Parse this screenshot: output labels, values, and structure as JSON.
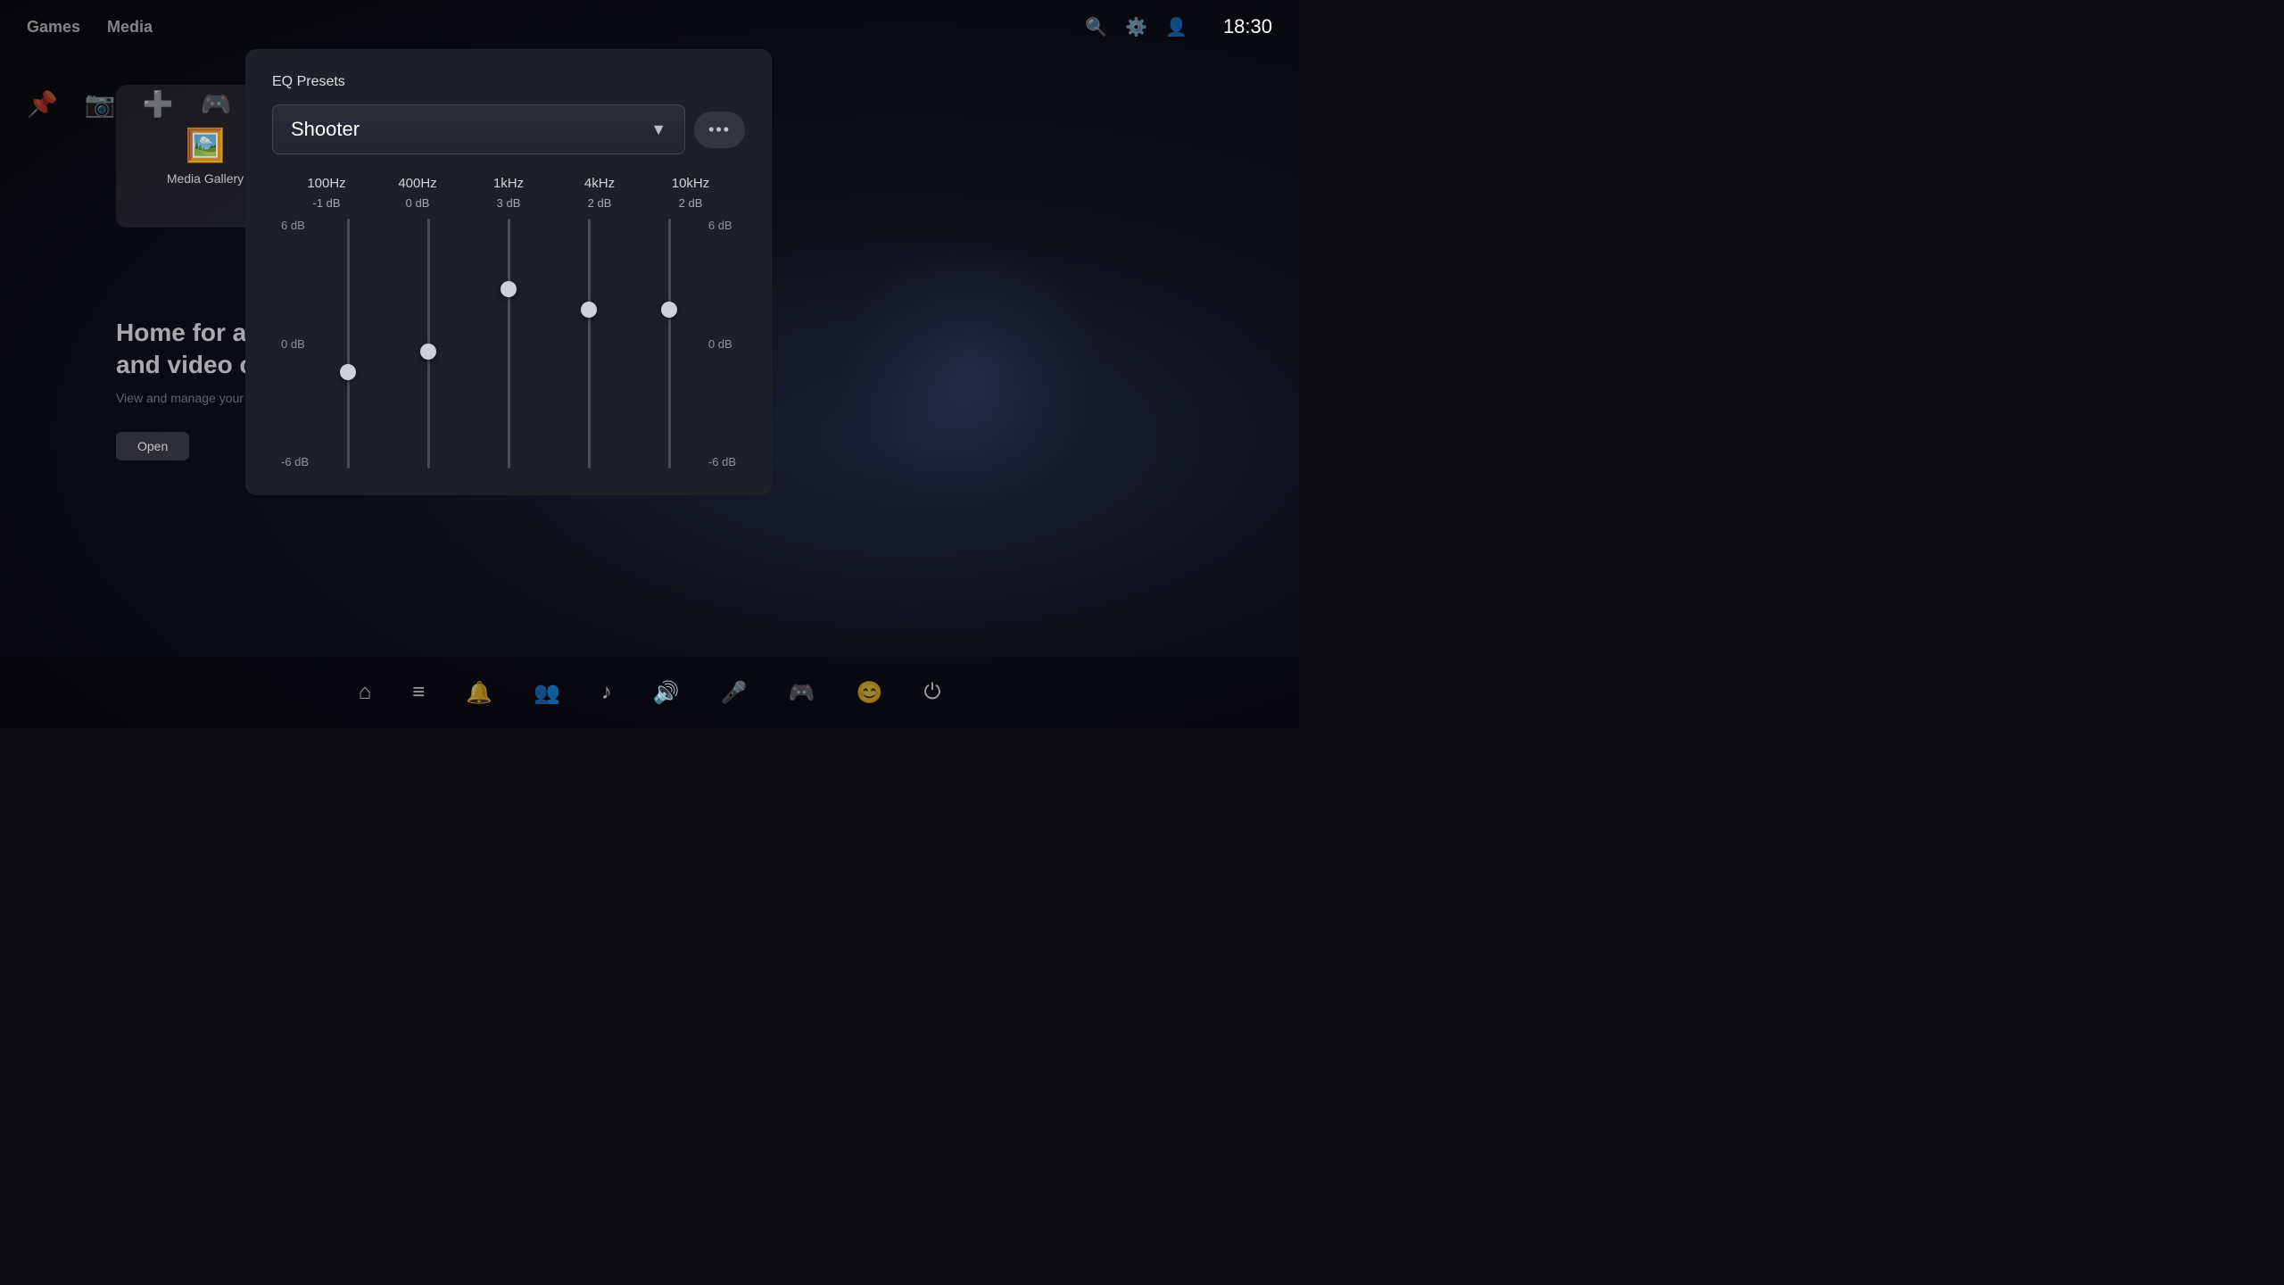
{
  "topNav": {
    "items": [
      "Games",
      "Media"
    ]
  },
  "clock": "18:30",
  "mediaGallery": {
    "label": "Media Gallery"
  },
  "pageContent": {
    "headline": "Home for all your s…",
    "subheadline": "and video clips",
    "description": "View and manage your saved me…",
    "openButton": "Open"
  },
  "eqDialog": {
    "title": "EQ Presets",
    "selectedPreset": "Shooter",
    "moreButton": "•••",
    "bands": [
      {
        "freq": "100Hz",
        "value": "-1 dB",
        "dbOffset": -1
      },
      {
        "freq": "400Hz",
        "value": "0 dB",
        "dbOffset": 0
      },
      {
        "freq": "1kHz",
        "value": "3 dB",
        "dbOffset": 3
      },
      {
        "freq": "4kHz",
        "value": "2 dB",
        "dbOffset": 2
      },
      {
        "freq": "10kHz",
        "value": "2 dB",
        "dbOffset": 2
      }
    ],
    "scaleLabels": [
      "6 dB",
      "0 dB",
      "-6 dB"
    ]
  },
  "taskbar": {
    "icons": [
      {
        "name": "home-icon",
        "symbol": "⌂",
        "active": false
      },
      {
        "name": "library-icon",
        "symbol": "≡",
        "active": false
      },
      {
        "name": "notifications-icon",
        "symbol": "🔔",
        "active": false
      },
      {
        "name": "friends-icon",
        "symbol": "👥",
        "active": false
      },
      {
        "name": "music-icon",
        "symbol": "♪",
        "active": false
      },
      {
        "name": "volume-icon",
        "symbol": "🔊",
        "active": true
      },
      {
        "name": "mic-icon",
        "symbol": "🎤",
        "active": false
      },
      {
        "name": "controller-icon",
        "symbol": "🎮",
        "active": false
      },
      {
        "name": "accessibility-icon",
        "symbol": "😊",
        "active": false
      },
      {
        "name": "power-icon",
        "symbol": "⏻",
        "active": false
      }
    ]
  }
}
